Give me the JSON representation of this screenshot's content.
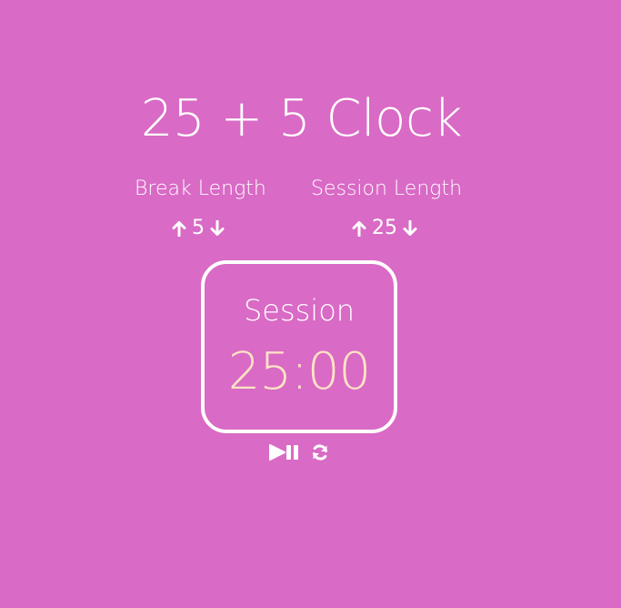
{
  "app": {
    "title": "25 + 5 Clock",
    "background_color": "#d96ac5",
    "timer_color": "#ffe4c4"
  },
  "break": {
    "label": "Break Length",
    "value": "5",
    "increment_icon": "arrow-up-icon",
    "decrement_icon": "arrow-down-icon"
  },
  "session": {
    "label": "Session Length",
    "value": "25",
    "increment_icon": "arrow-up-icon",
    "decrement_icon": "arrow-down-icon"
  },
  "timer": {
    "label": "Session",
    "time": "25:00"
  },
  "controls": {
    "start_stop_icon": "play-pause-icon",
    "reset_icon": "refresh-icon"
  }
}
